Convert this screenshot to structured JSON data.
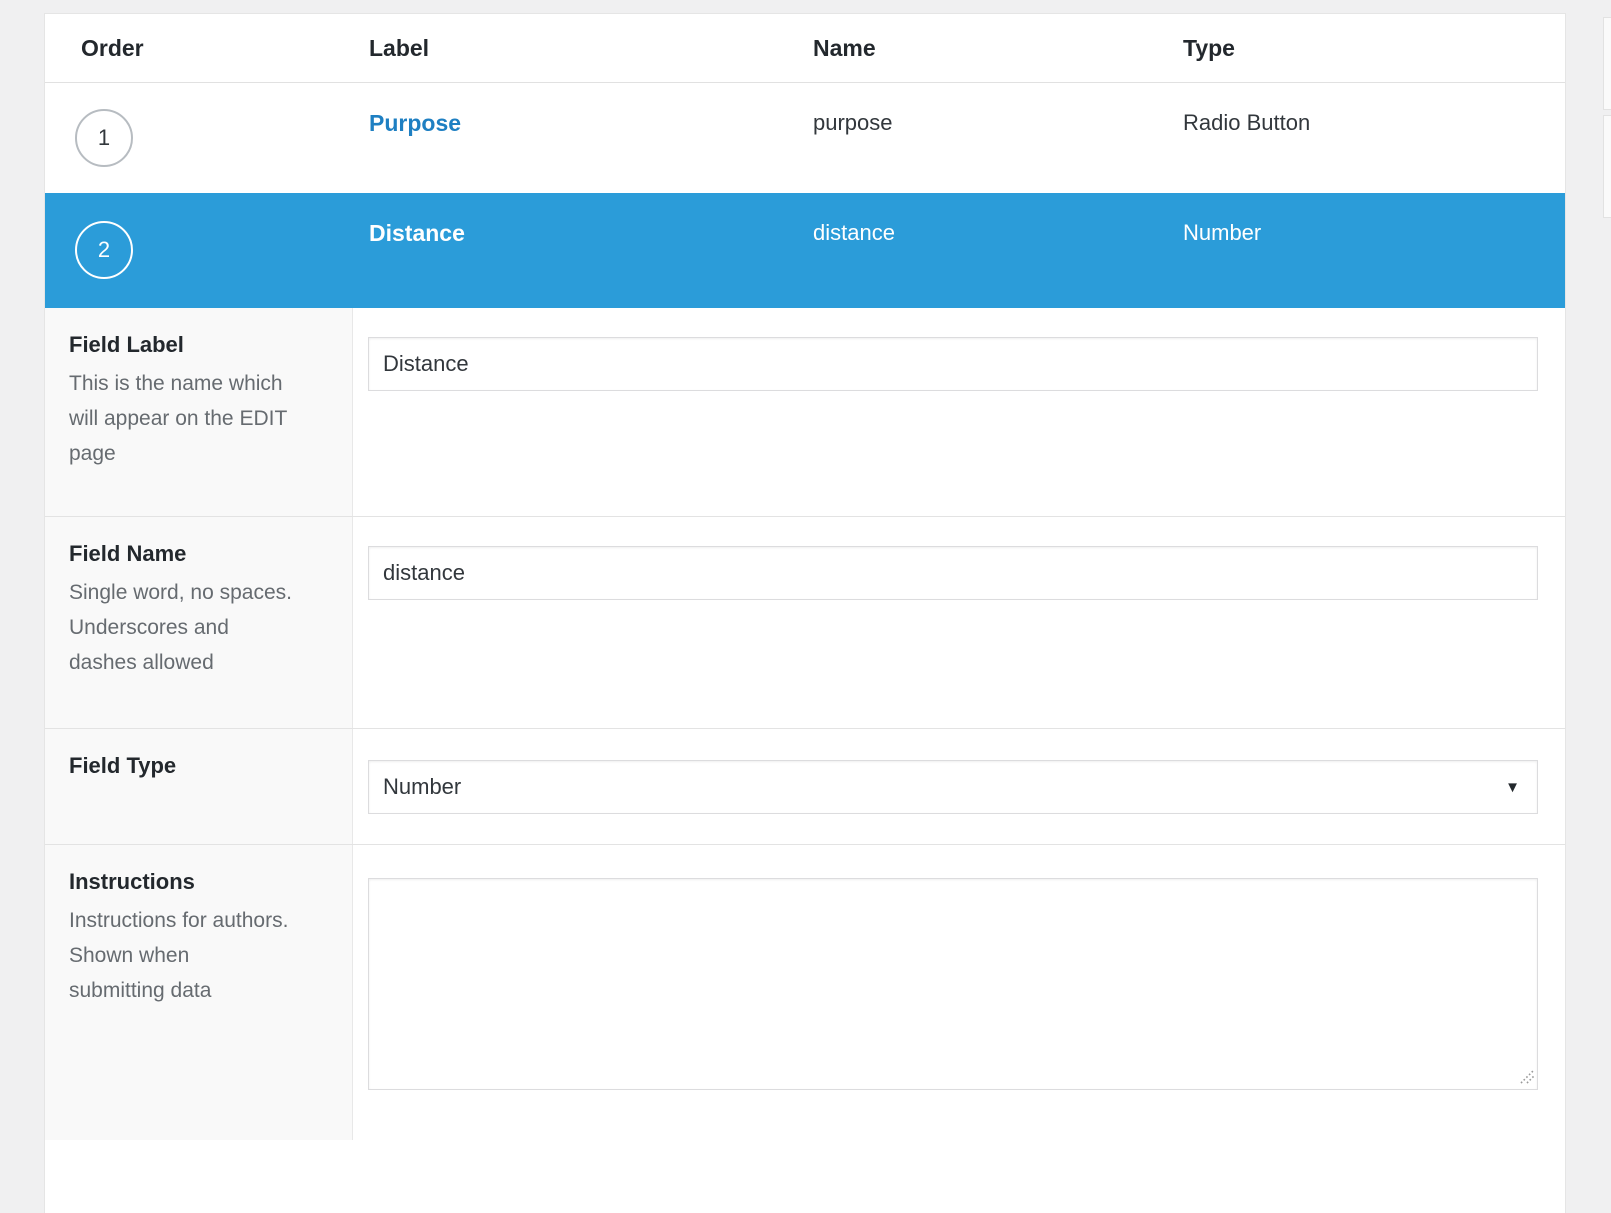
{
  "fields_table": {
    "headers": {
      "order": "Order",
      "label": "Label",
      "name": "Name",
      "type": "Type"
    },
    "rows": [
      {
        "order": "1",
        "label": "Purpose",
        "name": "purpose",
        "type": "Radio Button",
        "selected": false
      },
      {
        "order": "2",
        "label": "Distance",
        "name": "distance",
        "type": "Number",
        "selected": true
      }
    ]
  },
  "editor": {
    "field_label": {
      "title": "Field Label",
      "description": "This is the name which\nwill appear on the EDIT\npage",
      "value": "Distance"
    },
    "field_name": {
      "title": "Field Name",
      "description": "Single word, no spaces.\nUnderscores and\ndashes allowed",
      "value": "distance"
    },
    "field_type": {
      "title": "Field Type",
      "value": "Number"
    },
    "instructions": {
      "title": "Instructions",
      "description": "Instructions for authors.\nShown when\nsubmitting data",
      "value": ""
    }
  },
  "icons": {
    "dropdown": "▼"
  },
  "colors": {
    "selected_row": "#2b9cd9",
    "link": "#1e7fc2",
    "page_background": "#f0f0f1",
    "setting_label_background": "#f9f9f9",
    "border": "#e3e3e3"
  }
}
